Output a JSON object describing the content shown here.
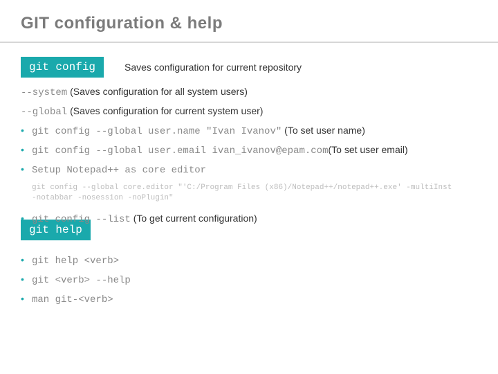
{
  "title": "GIT configuration & help",
  "tag1": "git config",
  "tag1_desc": "Saves configuration for current repository",
  "system_flag": "--system",
  "system_desc": " (Saves configuration for all system users)",
  "global_flag": "--global",
  "global_desc": " (Saves configuration for current system user)",
  "ex1_cmd": "git config --global user.name \"Ivan Ivanov\"",
  "ex1_note": "  (To set user name)",
  "ex2_cmd": "git config --global user.email ivan_ivanov@epam.com",
  "ex2_note": "(To set user email)",
  "ex3_cmd": "Setup Notepad++ as core editor",
  "codeblock_l1": "git config --global core.editor \"'C:/Program Files (x86)/Notepad++/notepad++.exe' -multiInst",
  "codeblock_l2": "-notabbar -nosession -noPlugin\"",
  "ex4_cmd": "git config --list",
  "ex4_note": "  (To get current configuration)",
  "tag2": "git help",
  "help1": "git help <verb>",
  "help2": "git <verb> --help",
  "help3": "man git-<verb>"
}
